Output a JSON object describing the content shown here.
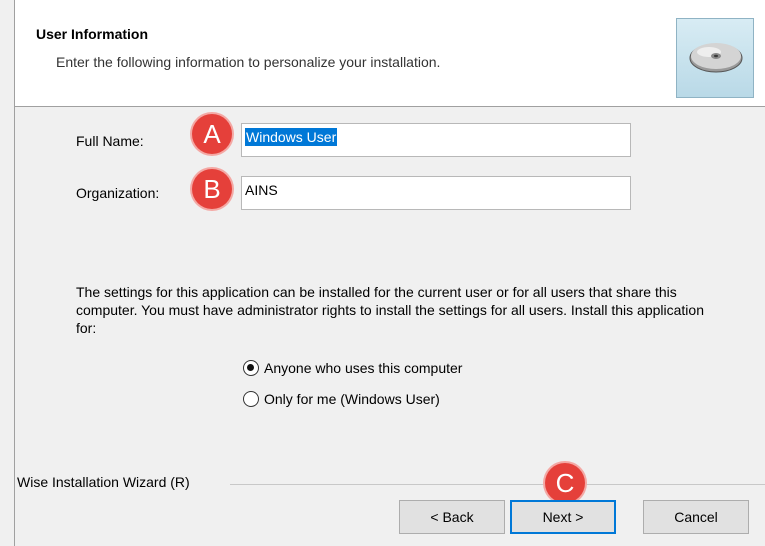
{
  "header": {
    "title": "User Information",
    "subtitle": "Enter the following information to personalize your installation.",
    "image_icon": "cd-disc-icon"
  },
  "form": {
    "full_name_label": "Full Name:",
    "full_name_value": "Windows User",
    "organization_label": "Organization:",
    "organization_value": "AINS"
  },
  "annotations": {
    "a": "A",
    "b": "B",
    "c": "C",
    "color": "#e5403a"
  },
  "install_scope": {
    "description": "The settings for this application can be installed for the current user or for all users that share this computer. You must have administrator rights to install the settings for all users. Install this application for:",
    "options": [
      {
        "label": "Anyone who uses this computer",
        "selected": true
      },
      {
        "label": "Only for me (Windows User)",
        "selected": false
      }
    ]
  },
  "footer": {
    "brand": "Wise Installation Wizard (R)",
    "back_label": "< Back",
    "next_label": "Next >",
    "cancel_label": "Cancel"
  },
  "colors": {
    "selection": "#0078d7",
    "default_button_border": "#0078d7"
  }
}
